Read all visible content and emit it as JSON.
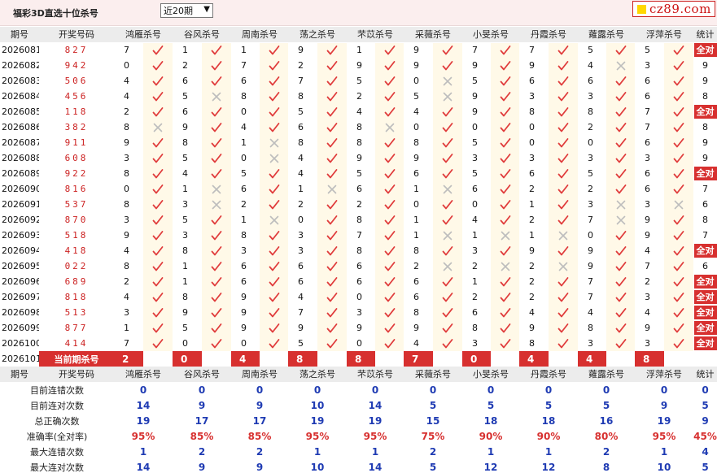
{
  "header": {
    "title": "福彩3D直选十位杀号",
    "period_select": "近20期",
    "logo_text": "cz89.com"
  },
  "columns": {
    "period": "期号",
    "numbers": "开奖号码",
    "experts": [
      "鸿雁杀号",
      "谷风杀号",
      "周南杀号",
      "荡之杀号",
      "芣苡杀号",
      "采薇杀号",
      "小旻杀号",
      "丹霞杀号",
      "蕹露杀号",
      "浮萍杀号"
    ],
    "stat": "统计"
  },
  "rows": [
    {
      "period": "2026081",
      "numbers": "827",
      "kills": [
        7,
        1,
        1,
        9,
        1,
        9,
        7,
        7,
        5,
        5
      ],
      "ok": [
        1,
        1,
        1,
        1,
        1,
        1,
        1,
        1,
        1,
        1
      ],
      "stat": "全对"
    },
    {
      "period": "2026082",
      "numbers": "942",
      "kills": [
        0,
        2,
        7,
        2,
        9,
        9,
        9,
        9,
        4,
        3
      ],
      "ok": [
        1,
        1,
        1,
        1,
        1,
        1,
        1,
        1,
        0,
        1
      ],
      "stat": "9"
    },
    {
      "period": "2026083",
      "numbers": "506",
      "kills": [
        4,
        6,
        6,
        7,
        5,
        0,
        5,
        6,
        6,
        6
      ],
      "ok": [
        1,
        1,
        1,
        1,
        1,
        0,
        1,
        1,
        1,
        1
      ],
      "stat": "9"
    },
    {
      "period": "2026084",
      "numbers": "456",
      "kills": [
        4,
        5,
        8,
        8,
        2,
        5,
        9,
        3,
        3,
        6
      ],
      "ok": [
        1,
        0,
        1,
        1,
        1,
        0,
        1,
        1,
        1,
        1
      ],
      "stat": "8"
    },
    {
      "period": "2026085",
      "numbers": "118",
      "kills": [
        2,
        6,
        0,
        5,
        4,
        4,
        9,
        8,
        8,
        7
      ],
      "ok": [
        1,
        1,
        1,
        1,
        1,
        1,
        1,
        1,
        1,
        1
      ],
      "stat": "全对"
    },
    {
      "period": "2026086",
      "numbers": "382",
      "kills": [
        8,
        9,
        4,
        6,
        8,
        0,
        0,
        0,
        2,
        7
      ],
      "ok": [
        0,
        1,
        1,
        1,
        0,
        1,
        1,
        1,
        1,
        1
      ],
      "stat": "8"
    },
    {
      "period": "2026087",
      "numbers": "911",
      "kills": [
        9,
        8,
        1,
        8,
        8,
        8,
        5,
        0,
        0,
        6
      ],
      "ok": [
        1,
        1,
        0,
        1,
        1,
        1,
        1,
        1,
        1,
        1
      ],
      "stat": "9"
    },
    {
      "period": "2026088",
      "numbers": "608",
      "kills": [
        3,
        5,
        0,
        4,
        9,
        9,
        3,
        3,
        3,
        3
      ],
      "ok": [
        1,
        1,
        0,
        1,
        1,
        1,
        1,
        1,
        1,
        1
      ],
      "stat": "9"
    },
    {
      "period": "2026089",
      "numbers": "922",
      "kills": [
        8,
        4,
        5,
        4,
        5,
        6,
        5,
        6,
        5,
        6
      ],
      "ok": [
        1,
        1,
        1,
        1,
        1,
        1,
        1,
        1,
        1,
        1
      ],
      "stat": "全对"
    },
    {
      "period": "2026090",
      "numbers": "816",
      "kills": [
        0,
        1,
        6,
        1,
        6,
        1,
        6,
        2,
        2,
        6
      ],
      "ok": [
        1,
        0,
        1,
        0,
        1,
        0,
        1,
        1,
        1,
        1
      ],
      "stat": "7"
    },
    {
      "period": "2026091",
      "numbers": "537",
      "kills": [
        8,
        3,
        2,
        2,
        2,
        0,
        0,
        1,
        3,
        3
      ],
      "ok": [
        1,
        0,
        1,
        1,
        1,
        1,
        1,
        1,
        0,
        0
      ],
      "stat": "6"
    },
    {
      "period": "2026092",
      "numbers": "870",
      "kills": [
        3,
        5,
        1,
        0,
        8,
        1,
        4,
        2,
        7,
        9
      ],
      "ok": [
        1,
        1,
        0,
        1,
        1,
        1,
        1,
        1,
        0,
        1
      ],
      "stat": "8"
    },
    {
      "period": "2026093",
      "numbers": "518",
      "kills": [
        9,
        3,
        8,
        3,
        7,
        1,
        1,
        1,
        0,
        9
      ],
      "ok": [
        1,
        1,
        1,
        1,
        1,
        0,
        0,
        0,
        1,
        1
      ],
      "stat": "7"
    },
    {
      "period": "2026094",
      "numbers": "418",
      "kills": [
        4,
        8,
        3,
        3,
        8,
        8,
        3,
        9,
        9,
        4
      ],
      "ok": [
        1,
        1,
        1,
        1,
        1,
        1,
        1,
        1,
        1,
        1
      ],
      "stat": "全对"
    },
    {
      "period": "2026095",
      "numbers": "022",
      "kills": [
        8,
        1,
        6,
        6,
        6,
        2,
        2,
        2,
        9,
        7
      ],
      "ok": [
        1,
        1,
        1,
        1,
        1,
        0,
        0,
        0,
        1,
        1
      ],
      "stat": "6"
    },
    {
      "period": "2026096",
      "numbers": "689",
      "kills": [
        2,
        1,
        6,
        6,
        6,
        6,
        1,
        2,
        7,
        2
      ],
      "ok": [
        1,
        1,
        1,
        1,
        1,
        1,
        1,
        1,
        1,
        1
      ],
      "stat": "全对"
    },
    {
      "period": "2026097",
      "numbers": "818",
      "kills": [
        4,
        8,
        9,
        4,
        0,
        6,
        2,
        2,
        7,
        3
      ],
      "ok": [
        1,
        1,
        1,
        1,
        1,
        1,
        1,
        1,
        1,
        1
      ],
      "stat": "全对"
    },
    {
      "period": "2026098",
      "numbers": "513",
      "kills": [
        3,
        9,
        9,
        7,
        3,
        8,
        6,
        4,
        4,
        4
      ],
      "ok": [
        1,
        1,
        1,
        1,
        1,
        1,
        1,
        1,
        1,
        1
      ],
      "stat": "全对"
    },
    {
      "period": "2026099",
      "numbers": "877",
      "kills": [
        1,
        5,
        9,
        9,
        9,
        9,
        8,
        9,
        8,
        9
      ],
      "ok": [
        1,
        1,
        1,
        1,
        1,
        1,
        1,
        1,
        1,
        1
      ],
      "stat": "全对"
    },
    {
      "period": "2026100",
      "numbers": "414",
      "kills": [
        7,
        0,
        0,
        5,
        0,
        4,
        3,
        8,
        3,
        3
      ],
      "ok": [
        1,
        1,
        1,
        1,
        1,
        1,
        1,
        1,
        1,
        1
      ],
      "stat": "全对"
    }
  ],
  "current": {
    "period": "2026101",
    "label": "当前期杀号",
    "kills": [
      "2",
      "0",
      "4",
      "8",
      "8",
      "7",
      "0",
      "4",
      "4",
      "8"
    ]
  },
  "stats_header": {
    "period": "期号",
    "numbers": "开奖号码",
    "experts": [
      "鸿雁杀号",
      "谷风杀号",
      "周南杀号",
      "荡之杀号",
      "芣苡杀号",
      "采薇杀号",
      "小旻杀号",
      "丹霞杀号",
      "蕹露杀号",
      "浮萍杀号"
    ],
    "stat": "统计"
  },
  "stats": [
    {
      "label": "目前连错次数",
      "values": [
        "0",
        "0",
        "0",
        "0",
        "0",
        "0",
        "0",
        "0",
        "0",
        "0",
        "0"
      ],
      "red": false
    },
    {
      "label": "目前连对次数",
      "values": [
        "14",
        "9",
        "9",
        "10",
        "14",
        "5",
        "5",
        "5",
        "5",
        "9",
        "5"
      ],
      "red": false
    },
    {
      "label": "总正确次数",
      "values": [
        "19",
        "17",
        "17",
        "19",
        "19",
        "15",
        "18",
        "18",
        "16",
        "19",
        "9"
      ],
      "red": false
    },
    {
      "label": "准确率(全对率)",
      "values": [
        "95%",
        "85%",
        "85%",
        "95%",
        "95%",
        "75%",
        "90%",
        "90%",
        "80%",
        "95%",
        "45%"
      ],
      "red": true
    },
    {
      "label": "最大连错次数",
      "values": [
        "1",
        "2",
        "2",
        "1",
        "1",
        "2",
        "1",
        "1",
        "2",
        "1",
        "4"
      ],
      "red": false
    },
    {
      "label": "最大连对次数",
      "values": [
        "14",
        "9",
        "9",
        "10",
        "14",
        "5",
        "12",
        "12",
        "8",
        "10",
        "5"
      ],
      "red": false
    }
  ],
  "colors": {
    "red": "#d7302f",
    "blue": "#1f3bb3",
    "check": "#e03c3c",
    "cross": "#bdbdbd",
    "mark_bg": "#fff9e8",
    "header_bg": "#ececec",
    "topbar_bg": "#fbeeee"
  },
  "icons": {
    "ok": "check-mark-icon",
    "miss": "cross-mark-icon"
  }
}
